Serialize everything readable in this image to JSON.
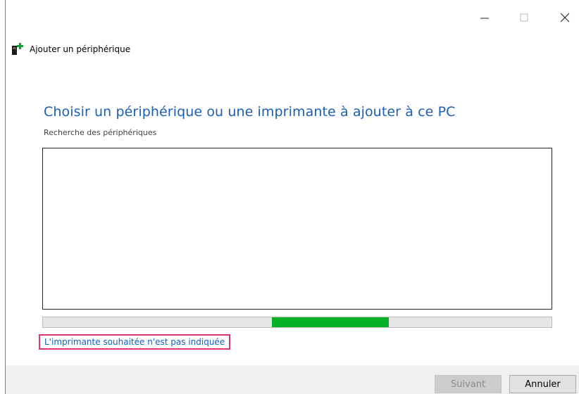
{
  "window": {
    "title": "Ajouter un périphérique",
    "controls": {
      "minimize_icon": "minimize-icon",
      "maximize_icon": "maximize-icon",
      "close_icon": "close-icon"
    }
  },
  "main": {
    "heading": "Choisir un périphérique ou une imprimante à ajouter à ce PC",
    "status": "Recherche des périphériques",
    "device_list": [],
    "progress": {
      "value": 0.45,
      "indeterminate": true
    },
    "link": "L'imprimante souhaitée n'est pas indiquée"
  },
  "footer": {
    "next_label": "Suivant",
    "cancel_label": "Annuler"
  },
  "colors": {
    "heading": "#1b5fb3",
    "link": "#0f5fc5",
    "progress": "#06b025",
    "highlight": "#e2336b",
    "window_border": "#3c86d4"
  }
}
